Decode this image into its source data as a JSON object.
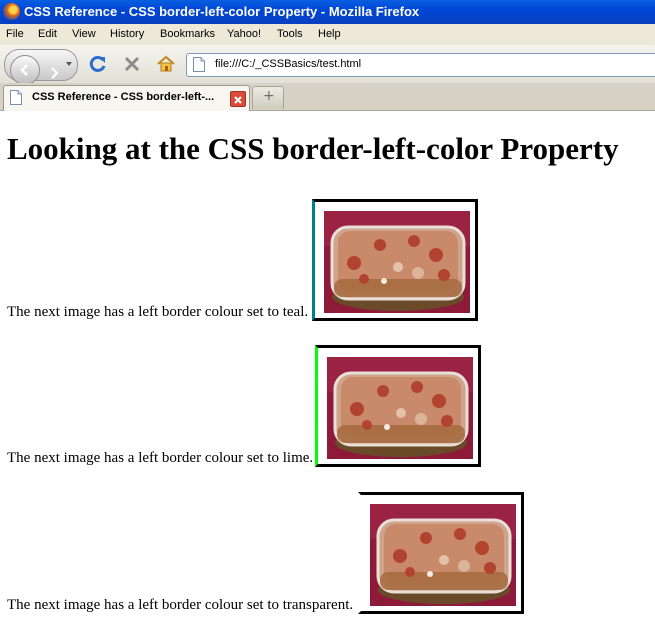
{
  "window": {
    "title": "CSS Reference - CSS border-left-color Property - Mozilla Firefox"
  },
  "menu": [
    "File",
    "Edit",
    "View",
    "History",
    "Bookmarks",
    "Yahoo!",
    "Tools",
    "Help"
  ],
  "nav": {
    "url": "file:///C:/_CSSBasics/test.html"
  },
  "tabs": [
    {
      "label": "CSS Reference - CSS border-left-..."
    }
  ],
  "page": {
    "heading": "Looking at the CSS border-left-color Property",
    "rows": [
      {
        "caption": "The next image has a left border colour set to teal.",
        "left_border_color": "#008080"
      },
      {
        "caption": "The next image has a left border colour set to lime.",
        "left_border_color": "#00ff00"
      },
      {
        "caption": "The next image has a left border colour set to transparent.",
        "left_border_color": "transparent"
      }
    ]
  },
  "colors": {
    "titlebar": "#0046d5",
    "teal": "#008080",
    "lime": "#00ff00"
  }
}
